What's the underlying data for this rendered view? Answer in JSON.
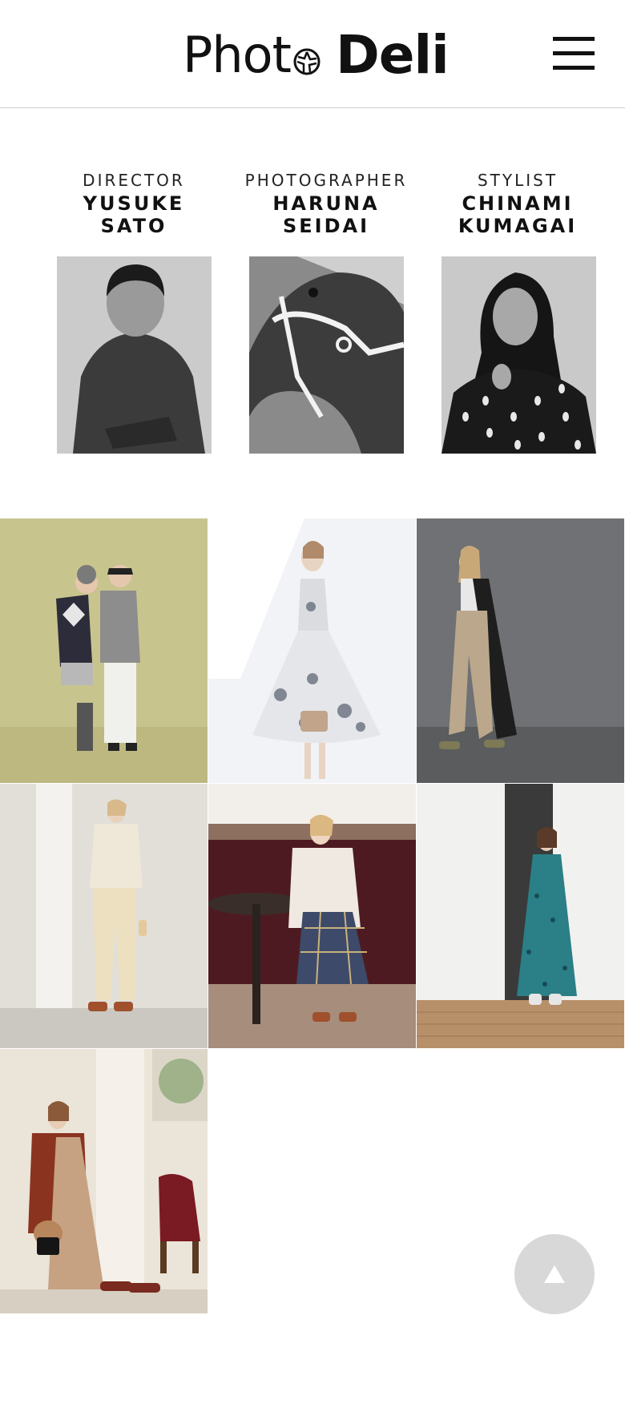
{
  "header": {
    "logo_photo": "Phot",
    "logo_deli": "Deli",
    "menu_icon": "hamburger-menu-icon"
  },
  "credits": [
    {
      "role": "DIRECTOR",
      "name_lines": [
        "YUSUKE SATO"
      ]
    },
    {
      "role": "PHOTOGRAPHER",
      "name_lines": [
        "HARUNA",
        "SEIDAI"
      ]
    },
    {
      "role": "STYLIST",
      "name_lines": [
        "CHINAMI",
        "KUMAGAI"
      ]
    }
  ],
  "scroll_top_icon": "up-triangle-icon",
  "colors": {
    "text": "#111111",
    "divider": "#cfcfcf",
    "scroll_button": "#d8d8d8"
  }
}
